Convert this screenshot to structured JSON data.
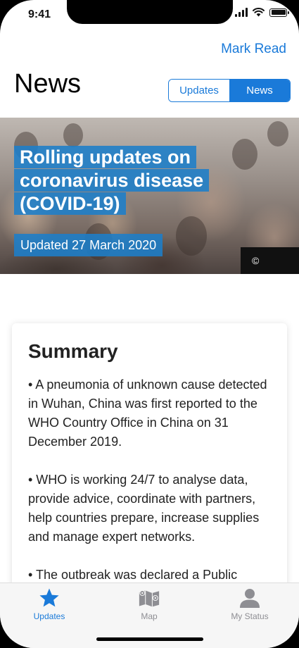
{
  "status_bar": {
    "time": "9:41"
  },
  "header": {
    "mark_read": "Mark Read",
    "title": "News",
    "segments": [
      {
        "label": "Updates",
        "selected": false
      },
      {
        "label": "News",
        "selected": true
      }
    ]
  },
  "hero": {
    "title": "Rolling updates on coronavirus disease (COVID-19)",
    "date": "Updated 27 March 2020",
    "copyright": "©"
  },
  "summary": {
    "title": "Summary",
    "paragraphs": [
      "• A pneumonia of unknown cause detected in Wuhan, China was first reported to the WHO Country Office in China on 31 December 2019.",
      "• WHO is working 24/7 to analyse data, provide advice, coordinate with partners, help countries prepare, increase supplies and manage expert networks.",
      "• The outbreak was declared a Public"
    ]
  },
  "tab_bar": {
    "tabs": [
      {
        "label": "Updates",
        "icon": "star-icon",
        "active": true
      },
      {
        "label": "Map",
        "icon": "map-icon",
        "active": false
      },
      {
        "label": "My Status",
        "icon": "person-icon",
        "active": false
      }
    ]
  },
  "colors": {
    "accent": "#1a7ad9",
    "hero_label_bg": "#1c7ec9",
    "tab_inactive": "#8e8e93"
  }
}
